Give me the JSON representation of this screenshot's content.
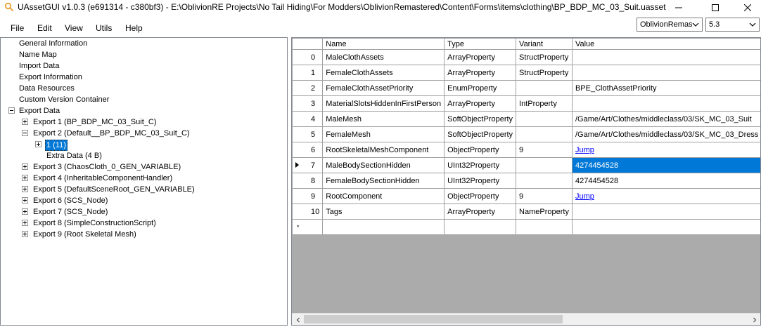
{
  "window": {
    "title": "UAssetGUI v1.0.3 (e691314 - c380bf3) - E:\\OblivionRE Projects\\No Tail Hiding\\For Modders\\OblivionRemastered\\Content\\Forms\\items\\clothing\\BP_BDP_MC_03_Suit.uasset",
    "minimize": "—",
    "maximize": "☐",
    "close": "✕",
    "accent": "#0078d7"
  },
  "menu": {
    "file": "File",
    "edit": "Edit",
    "view": "View",
    "utils": "Utils",
    "help": "Help"
  },
  "selectors": {
    "game": "OblivionRemastered",
    "version": "5.3"
  },
  "tree": {
    "general_information": "General Information",
    "name_map": "Name Map",
    "import_data": "Import Data",
    "export_information": "Export Information",
    "data_resources": "Data Resources",
    "custom_version_container": "Custom Version Container",
    "export_data": "Export Data",
    "export_1": "Export 1 (BP_BDP_MC_03_Suit_C)",
    "export_2": "Export 2 (Default__BP_BDP_MC_03_Suit_C)",
    "export_2_child": "1 (11)",
    "export_2_extra": "Extra Data (4 B)",
    "export_3": "Export 3 (ChaosCloth_0_GEN_VARIABLE)",
    "export_4": "Export 4 (InheritableComponentHandler)",
    "export_5": "Export 5 (DefaultSceneRoot_GEN_VARIABLE)",
    "export_6": "Export 6 (SCS_Node)",
    "export_7": "Export 7 (SCS_Node)",
    "export_8": "Export 8 (SimpleConstructionScript)",
    "export_9": "Export 9 (Root Skeletal Mesh)"
  },
  "grid": {
    "columns": {
      "index": "",
      "name": "Name",
      "type": "Type",
      "variant": "Variant",
      "value": "Value"
    },
    "rows": [
      {
        "index": "0",
        "name": "MaleClothAssets",
        "type": "ArrayProperty",
        "variant": "StructProperty",
        "value": ""
      },
      {
        "index": "1",
        "name": "FemaleClothAssets",
        "type": "ArrayProperty",
        "variant": "StructProperty",
        "value": ""
      },
      {
        "index": "2",
        "name": "FemaleClothAssetPriority",
        "type": "EnumProperty",
        "variant": "",
        "value": "BPE_ClothAssetPriority"
      },
      {
        "index": "3",
        "name": "MaterialSlotsHiddenInFirstPerson",
        "type": "ArrayProperty",
        "variant": "IntProperty",
        "value": ""
      },
      {
        "index": "4",
        "name": "MaleMesh",
        "type": "SoftObjectProperty",
        "variant": "",
        "value": "/Game/Art/Clothes/middleclass/03/SK_MC_03_Suit"
      },
      {
        "index": "5",
        "name": "FemaleMesh",
        "type": "SoftObjectProperty",
        "variant": "",
        "value": "/Game/Art/Clothes/middleclass/03/SK_MC_03_Dress"
      },
      {
        "index": "6",
        "name": "RootSkeletalMeshComponent",
        "type": "ObjectProperty",
        "variant": "9",
        "value": "Jump"
      },
      {
        "index": "7",
        "name": "MaleBodySectionHidden",
        "type": "UInt32Property",
        "variant": "",
        "value": "4274454528"
      },
      {
        "index": "8",
        "name": "FemaleBodySectionHidden",
        "type": "UInt32Property",
        "variant": "",
        "value": "4274454528"
      },
      {
        "index": "9",
        "name": "RootComponent",
        "type": "ObjectProperty",
        "variant": "9",
        "value": "Jump"
      },
      {
        "index": "10",
        "name": "Tags",
        "type": "ArrayProperty",
        "variant": "NameProperty",
        "value": ""
      }
    ],
    "new_row_marker": "*",
    "selected_row": 7
  }
}
